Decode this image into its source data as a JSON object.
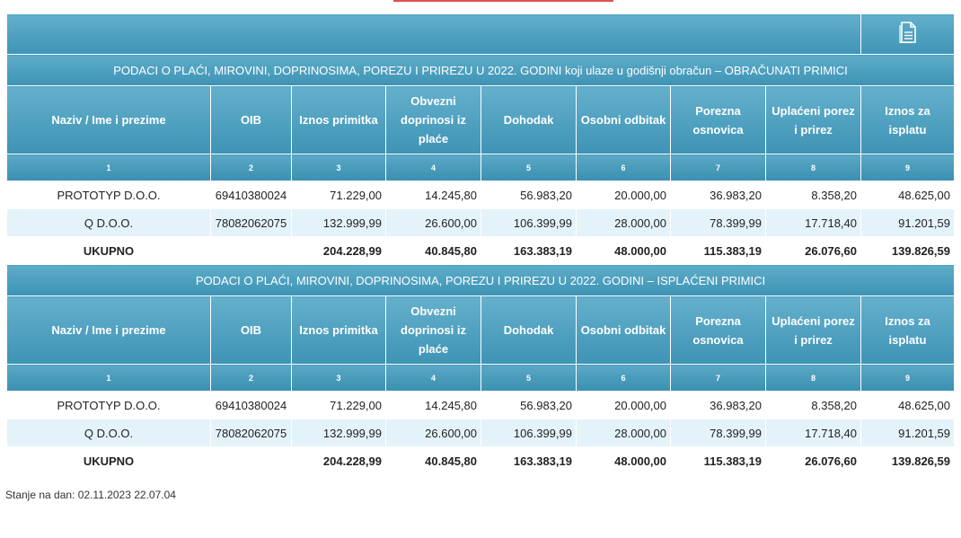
{
  "toolbar": {
    "icon": "document-icon"
  },
  "columns": {
    "names": [
      "Naziv / Ime i prezime",
      "OIB",
      "Iznos primitka",
      "Obvezni doprinosi iz plaće",
      "Dohodak",
      "Osobni odbitak",
      "Porezna osnovica",
      "Uplaćeni porez i prirez",
      "Iznos za isplatu"
    ],
    "numbers": [
      "1",
      "2",
      "3",
      "4",
      "5",
      "6",
      "7",
      "8",
      "9"
    ]
  },
  "sections": [
    {
      "title": "PODACI O PLAĆI, MIROVINI, DOPRINOSIMA, POREZU I PRIREZU U 2022. GODINI koji ulaze u godišnji obračun – OBRAČUNATI PRIMICI",
      "rows": [
        [
          "PROTOTYP D.O.O.",
          "69410380024",
          "71.229,00",
          "14.245,80",
          "56.983,20",
          "20.000,00",
          "36.983,20",
          "8.358,20",
          "48.625,00"
        ],
        [
          "Q D.O.O.",
          "78082062075",
          "132.999,99",
          "26.600,00",
          "106.399,99",
          "28.000,00",
          "78.399,99",
          "17.718,40",
          "91.201,59"
        ]
      ],
      "total": [
        "UKUPNO",
        "",
        "204.228,99",
        "40.845,80",
        "163.383,19",
        "48.000,00",
        "115.383,19",
        "26.076,60",
        "139.826,59"
      ]
    },
    {
      "title": "PODACI O PLAĆI, MIROVINI, DOPRINOSIMA, POREZU I PRIREZU U 2022. GODINI – ISPLAĆENI PRIMICI",
      "rows": [
        [
          "PROTOTYP D.O.O.",
          "69410380024",
          "71.229,00",
          "14.245,80",
          "56.983,20",
          "20.000,00",
          "36.983,20",
          "8.358,20",
          "48.625,00"
        ],
        [
          "Q D.O.O.",
          "78082062075",
          "132.999,99",
          "26.600,00",
          "106.399,99",
          "28.000,00",
          "78.399,99",
          "17.718,40",
          "91.201,59"
        ]
      ],
      "total": [
        "UKUPNO",
        "",
        "204.228,99",
        "40.845,80",
        "163.383,19",
        "48.000,00",
        "115.383,19",
        "26.076,60",
        "139.826,59"
      ]
    }
  ],
  "footer": {
    "status": "Stanje na dan: 02.11.2023 22.07.04"
  }
}
